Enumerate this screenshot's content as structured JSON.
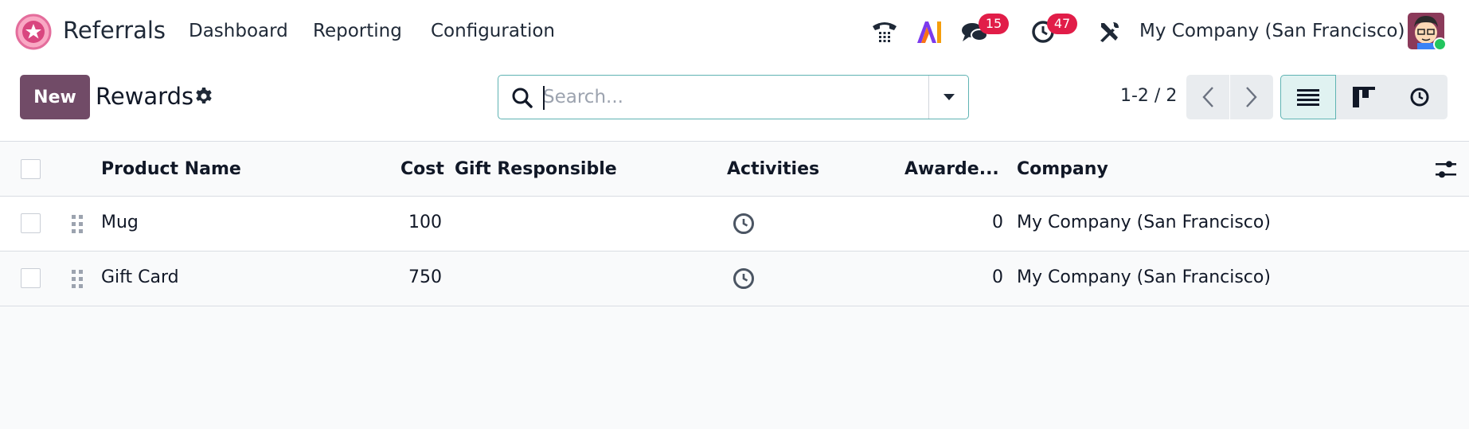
{
  "topbar": {
    "app_name": "Referrals",
    "menu": [
      "Dashboard",
      "Reporting",
      "Configuration"
    ],
    "messages_badge": "15",
    "activities_badge": "47",
    "company": "My Company (San Francisco)",
    "icons": [
      "phone-icon",
      "ai-icon",
      "chat-icon",
      "clock-icon",
      "tools-icon"
    ]
  },
  "control": {
    "new_label": "New",
    "title": "Rewards",
    "search_placeholder": "Search...",
    "pager": "1-2 / 2"
  },
  "table": {
    "headers": [
      "Product Name",
      "Cost",
      "Gift Responsible",
      "Activities",
      "Awarde...",
      "Company"
    ],
    "rows": [
      {
        "name": "Mug",
        "cost": "100",
        "gift_responsible": "",
        "awarded": "0",
        "company": "My Company (San Francisco)"
      },
      {
        "name": "Gift Card",
        "cost": "750",
        "gift_responsible": "",
        "awarded": "0",
        "company": "My Company (San Francisco)"
      }
    ]
  },
  "colors": {
    "brand": "#714b67",
    "badge": "#e11d48",
    "accent_border": "#5fb3b3",
    "background": "#f9fafb"
  }
}
